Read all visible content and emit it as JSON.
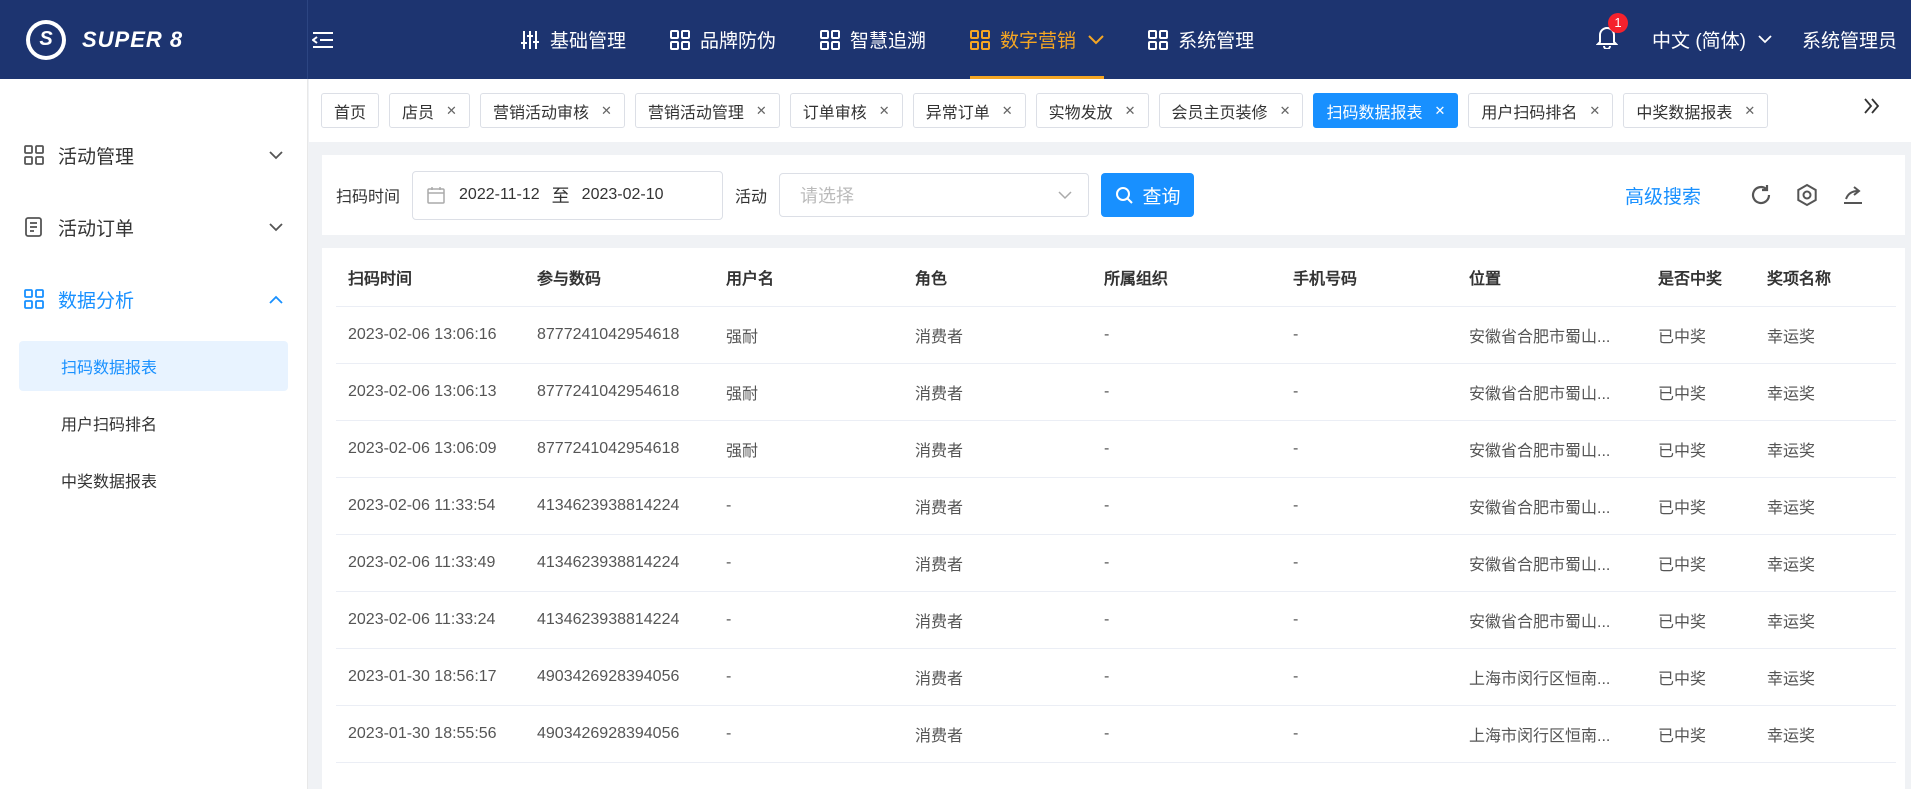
{
  "brand": {
    "name": "SUPER 8",
    "logo_letter": "S"
  },
  "nav": [
    {
      "label": "基础管理",
      "icon": "sliders-icon"
    },
    {
      "label": "品牌防伪",
      "icon": "grid-icon"
    },
    {
      "label": "智慧追溯",
      "icon": "grid-icon"
    },
    {
      "label": "数字营销",
      "icon": "grid-icon",
      "active": true
    },
    {
      "label": "系统管理",
      "icon": "grid-icon"
    }
  ],
  "header": {
    "notification_count": "1",
    "language": "中文 (简体)",
    "user": "系统管理员"
  },
  "sidebar": {
    "groups": [
      {
        "label": "活动管理"
      },
      {
        "label": "活动订单"
      },
      {
        "label": "数据分析"
      }
    ],
    "subitems": [
      {
        "label": "扫码数据报表"
      },
      {
        "label": "用户扫码排名"
      },
      {
        "label": "中奖数据报表"
      }
    ]
  },
  "tabs": [
    {
      "label": "首页"
    },
    {
      "label": "店员"
    },
    {
      "label": "营销活动审核"
    },
    {
      "label": "营销活动管理"
    },
    {
      "label": "订单审核"
    },
    {
      "label": "异常订单"
    },
    {
      "label": "实物发放"
    },
    {
      "label": "会员主页装修"
    },
    {
      "label": "扫码数据报表"
    },
    {
      "label": "用户扫码排名"
    },
    {
      "label": "中奖数据报表"
    }
  ],
  "search": {
    "scan_time_label": "扫码时间",
    "date_start": "2022-11-12",
    "date_sep": "至",
    "date_end": "2023-02-10",
    "activity_label": "活动",
    "activity_placeholder": "请选择",
    "query_label": "查询",
    "advanced_label": "高级搜索"
  },
  "table": {
    "columns": [
      "扫码时间",
      "参与数码",
      "用户名",
      "角色",
      "所属组织",
      "手机号码",
      "位置",
      "是否中奖",
      "奖项名称"
    ],
    "rows": [
      [
        "2023-02-06 13:06:16",
        "8777241042954618",
        "强耐",
        "消费者",
        "-",
        "-",
        "安徽省合肥市蜀山...",
        "已中奖",
        "幸运奖"
      ],
      [
        "2023-02-06 13:06:13",
        "8777241042954618",
        "强耐",
        "消费者",
        "-",
        "-",
        "安徽省合肥市蜀山...",
        "已中奖",
        "幸运奖"
      ],
      [
        "2023-02-06 13:06:09",
        "8777241042954618",
        "强耐",
        "消费者",
        "-",
        "-",
        "安徽省合肥市蜀山...",
        "已中奖",
        "幸运奖"
      ],
      [
        "2023-02-06 11:33:54",
        "4134623938814224",
        "-",
        "消费者",
        "-",
        "-",
        "安徽省合肥市蜀山...",
        "已中奖",
        "幸运奖"
      ],
      [
        "2023-02-06 11:33:49",
        "4134623938814224",
        "-",
        "消费者",
        "-",
        "-",
        "安徽省合肥市蜀山...",
        "已中奖",
        "幸运奖"
      ],
      [
        "2023-02-06 11:33:24",
        "4134623938814224",
        "-",
        "消费者",
        "-",
        "-",
        "安徽省合肥市蜀山...",
        "已中奖",
        "幸运奖"
      ],
      [
        "2023-01-30 18:56:17",
        "4903426928394056",
        "-",
        "消费者",
        "-",
        "-",
        "上海市闵行区恒南...",
        "已中奖",
        "幸运奖"
      ],
      [
        "2023-01-30 18:55:56",
        "4903426928394056",
        "-",
        "消费者",
        "-",
        "-",
        "上海市闵行区恒南...",
        "已中奖",
        "幸运奖"
      ]
    ]
  },
  "colors": {
    "topbar": "#1d3470",
    "accent": "#f5a623",
    "primary": "#1890ff",
    "badge": "#f5222d"
  }
}
